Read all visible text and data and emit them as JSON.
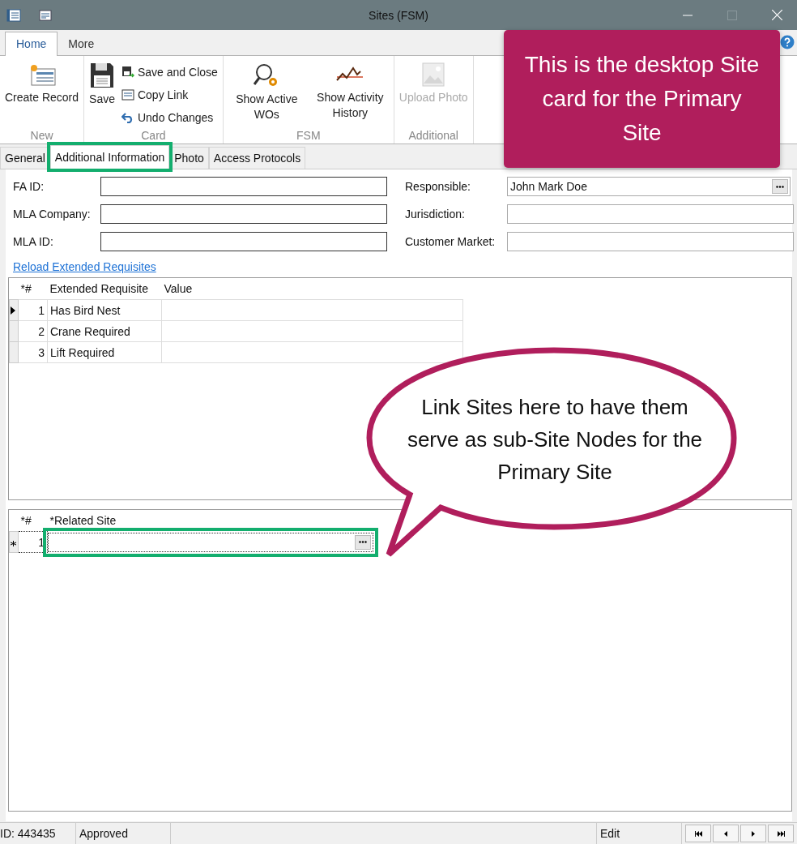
{
  "window": {
    "title": "Sites (FSM)"
  },
  "ribbon_tabs": [
    {
      "label": "Home",
      "selected": true
    },
    {
      "label": "More",
      "selected": false
    }
  ],
  "ribbon_groups": [
    {
      "label": "New",
      "buttons": [
        {
          "label": "Create Record",
          "kind": "large",
          "disabled": false
        }
      ]
    },
    {
      "label": "Card",
      "buttons": [
        {
          "label": "Save",
          "kind": "large",
          "disabled": false
        },
        {
          "label": "Save and Close",
          "kind": "small",
          "disabled": false
        },
        {
          "label": "Copy Link",
          "kind": "small",
          "disabled": false
        },
        {
          "label": "Undo Changes",
          "kind": "small",
          "disabled": false
        }
      ]
    },
    {
      "label": "FSM",
      "buttons": [
        {
          "label": "Show Active WOs",
          "kind": "large",
          "disabled": false
        },
        {
          "label": "Show Activity History",
          "kind": "large",
          "disabled": false
        }
      ]
    },
    {
      "label": "Additional",
      "buttons": [
        {
          "label": "Upload Photo",
          "kind": "large",
          "disabled": true
        }
      ]
    }
  ],
  "doc_tabs": [
    {
      "label": "General",
      "selected": false,
      "highlighted": false
    },
    {
      "label": "Additional Information",
      "selected": true,
      "highlighted": true
    },
    {
      "label": "Photo",
      "selected": false,
      "highlighted": false
    },
    {
      "label": "Access Protocols",
      "selected": false,
      "highlighted": false
    }
  ],
  "form_left": [
    {
      "label": "FA ID:"
    },
    {
      "label": "MLA Company:"
    },
    {
      "label": "MLA ID:"
    }
  ],
  "form_right": [
    {
      "label": "Responsible:",
      "value": "John Mark Doe",
      "kind": "lookup"
    },
    {
      "label": "Jurisdiction:",
      "kind": "text"
    },
    {
      "label": "Customer Market:",
      "kind": "text"
    }
  ],
  "reload_link": "Reload Extended Requisites",
  "requisites_grid": {
    "columns": [
      "*#",
      "Extended Requisite",
      "Value"
    ],
    "rows": [
      {
        "number": "1",
        "requisite": "Has Bird Nest",
        "current": true
      },
      {
        "number": "2",
        "requisite": "Crane Required",
        "current": false
      },
      {
        "number": "3",
        "requisite": "Lift Required",
        "current": false
      }
    ]
  },
  "related_grid": {
    "columns": [
      "*#",
      "*Related Site"
    ],
    "rows": [
      {
        "number": "1",
        "kind": "new",
        "highlighted": true
      }
    ]
  },
  "status_bar": {
    "id": "ID: 443435",
    "status": "Approved",
    "mode": "Edit"
  },
  "callouts": [
    {
      "kind": "box",
      "text": "This is the desktop Site card for the Primary Site"
    },
    {
      "kind": "bubble",
      "text": "Link Sites here to have them serve as sub-Site Nodes for the Primary Site"
    }
  ]
}
